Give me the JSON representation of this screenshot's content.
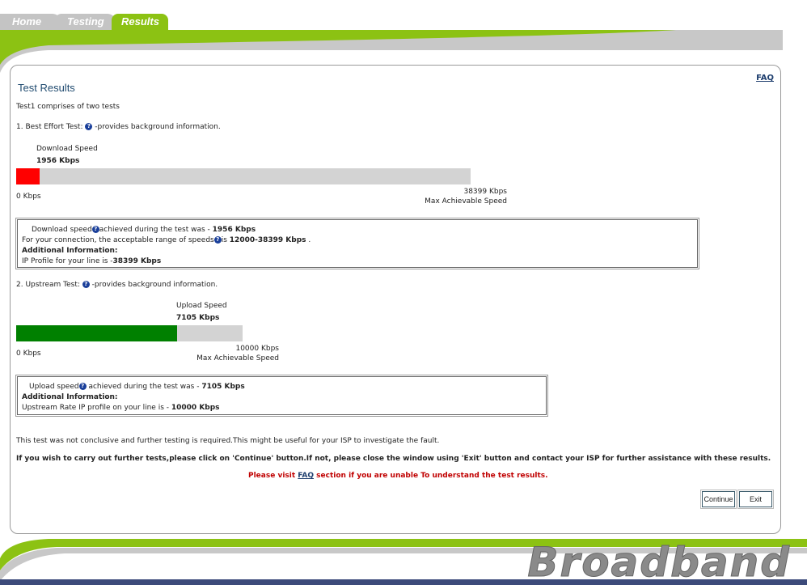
{
  "tabs": {
    "home": "Home",
    "testing": "Testing",
    "results": "Results"
  },
  "faq_link": "FAQ",
  "title": "Test Results",
  "intro": "Test1 comprises of two tests",
  "help_glyph": "?",
  "best_effort": {
    "label": "1. Best Effort Test:",
    "suffix": "-provides background information.",
    "speed_label": "Download Speed",
    "speed_value": "1956 Kbps",
    "bar_fraction": 0.051,
    "min_label": "0 Kbps",
    "max_value": "38399 Kbps",
    "max_label": "Max Achievable Speed",
    "bar_color": "#ff0000",
    "box": {
      "line1_pre": "Download speed",
      "line1_mid": "achieved during the test was - ",
      "line1_val": "1956 Kbps",
      "line2_pre": "For your connection, the acceptable range of speeds",
      "line2_mid": "is ",
      "line2_val": "12000-38399 Kbps",
      "line2_end": " .",
      "additional": "Additional Information:",
      "line4_pre": "IP Profile for your line is -",
      "line4_val": "38399 Kbps"
    }
  },
  "upstream": {
    "label": "2. Upstream Test:",
    "suffix": "-provides background information.",
    "speed_label": "Upload Speed",
    "speed_value": "7105 Kbps",
    "bar_fraction": 0.7105,
    "min_label": "0 Kbps",
    "max_value": "10000 Kbps",
    "max_label": "Max Achievable Speed",
    "bar_color": "#008000",
    "box": {
      "line1_pre": "Upload speed",
      "line1_mid": " achieved during the test was - ",
      "line1_val": "7105 Kbps",
      "additional": "Additional Information:",
      "line3_pre": "Upstream Rate IP profile on your line is - ",
      "line3_val": "10000 Kbps"
    }
  },
  "conclusion": "This test was not conclusive and further testing is required.This might be useful for your ISP to investigate the fault.",
  "instruction": "If you wish to carry out further tests,please click on 'Continue' button.If not, please close the window using 'Exit' button and contact your ISP for further assistance with these results.",
  "visit_pre": "Please visit ",
  "visit_link": "FAQ",
  "visit_post": " section if you are unable To understand the test results.",
  "buttons": {
    "continue": "Continue",
    "exit": "Exit"
  },
  "brand": "Broadband",
  "colors": {
    "accent_green": "#8cc213",
    "tab_gray": "#c4c4c4",
    "title_blue": "#1f4a6f"
  }
}
